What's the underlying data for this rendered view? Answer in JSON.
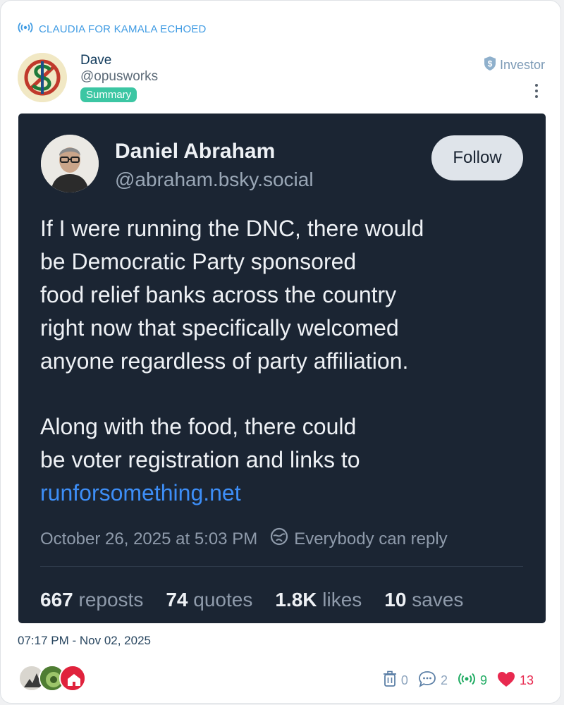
{
  "echo": {
    "label": "CLAUDIA FOR KAMALA ECHOED"
  },
  "user": {
    "name": "Dave",
    "handle": "@opusworks",
    "badge": "Summary",
    "role": "Investor"
  },
  "embed": {
    "author_name": "Daniel Abraham",
    "author_handle": "@abraham.bsky.social",
    "follow_label": "Follow",
    "paragraph1_lines": [
      "If I were running the DNC, there would",
      "be Democratic Party sponsored",
      "food relief banks across the country",
      "right now that specifically welcomed",
      "anyone regardless of party affiliation."
    ],
    "paragraph2_lines": [
      "Along with the food, there could",
      "be voter registration and links to"
    ],
    "link": "runforsomething.net",
    "date": "October 26, 2025 at 5:03 PM",
    "reply_setting": "Everybody can reply",
    "stats": [
      {
        "num": "667",
        "label": "reposts"
      },
      {
        "num": "74",
        "label": "quotes"
      },
      {
        "num": "1.8K",
        "label": "likes"
      },
      {
        "num": "10",
        "label": "saves"
      }
    ]
  },
  "timestamp": "07:17 PM - Nov 02, 2025",
  "actions": {
    "trash_count": "0",
    "comments_count": "2",
    "echoes_count": "9",
    "likes_count": "13"
  },
  "colors": {
    "accent": "#3f9be3",
    "badge": "#3cc6a3",
    "embed_bg": "#1b2533",
    "link": "#3d8ef7",
    "heart": "#e8294f",
    "echo_green": "#1fab62"
  }
}
